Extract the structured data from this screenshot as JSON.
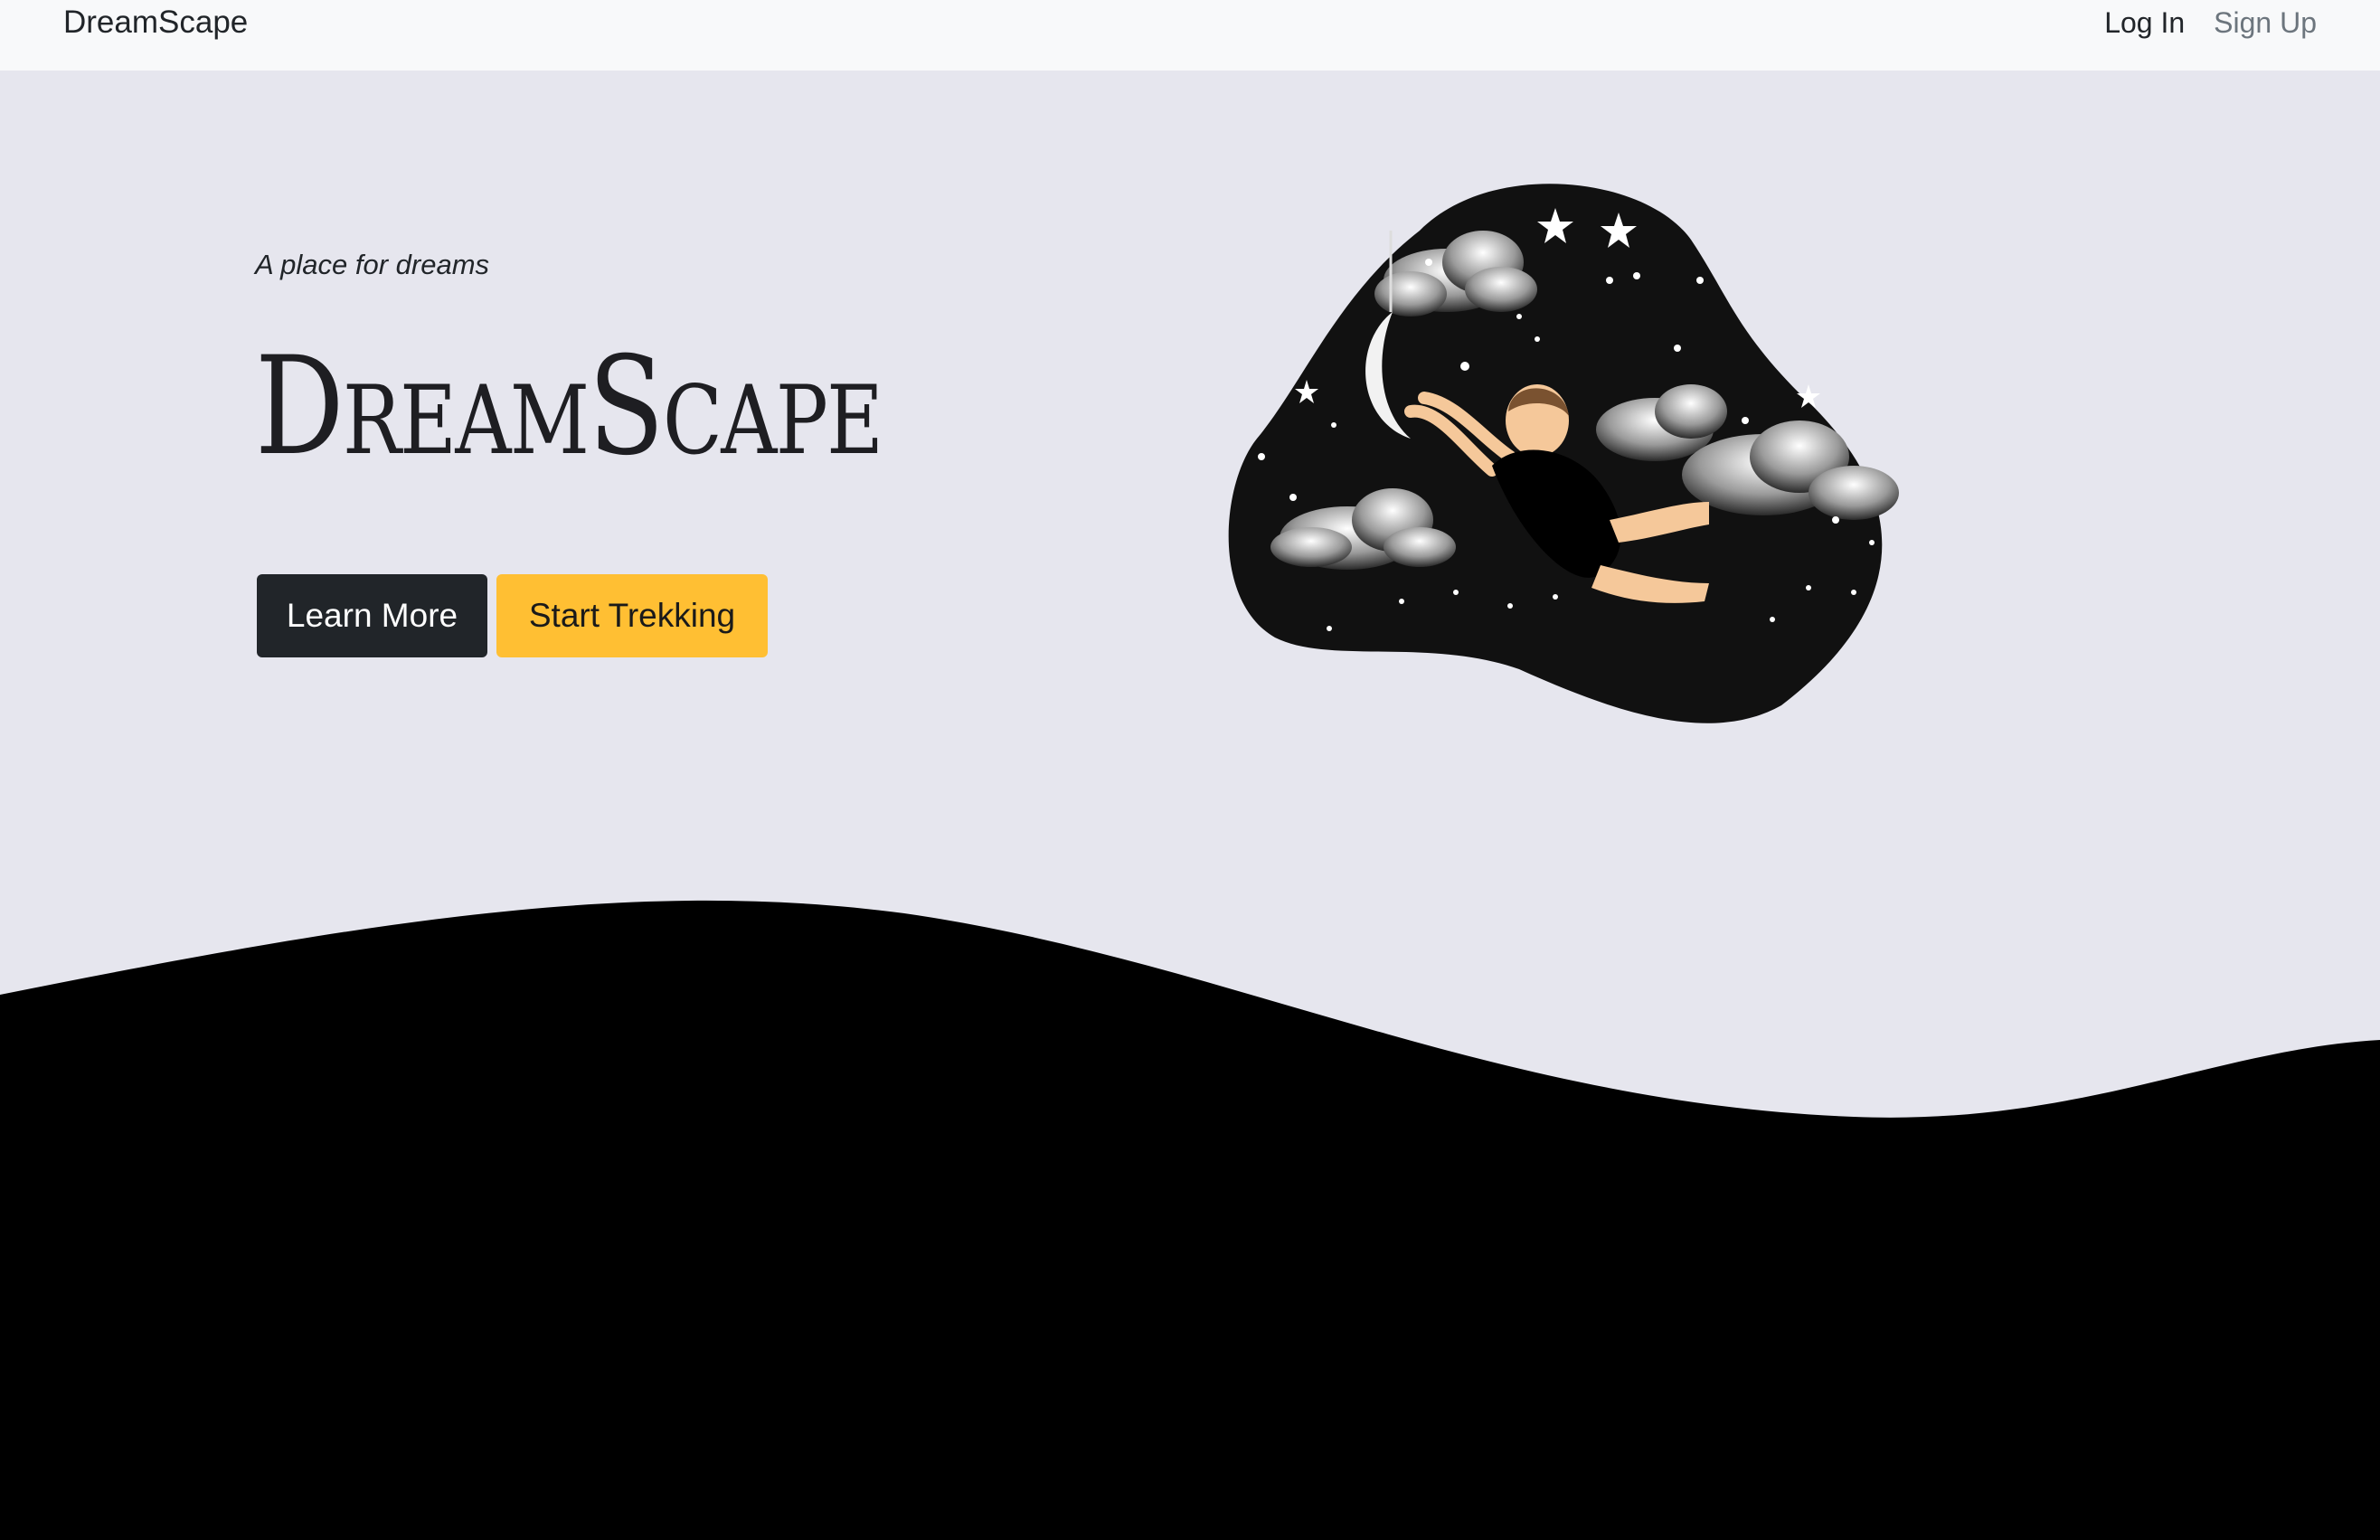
{
  "navbar": {
    "brand": "DreamScape",
    "links": [
      {
        "label": "Log In"
      },
      {
        "label": "Sign Up"
      }
    ]
  },
  "hero": {
    "tagline": "A place for dreams",
    "title": "DreamScape",
    "buttons": {
      "learn_more": "Learn More",
      "start_trekking": "Start Trekking"
    },
    "illustration_icon": "dreamer-reaching-for-moon"
  },
  "colors": {
    "page_bg": "#e6e6ee",
    "navbar_bg": "#f8f9fa",
    "dark_button": "#212529",
    "warning_button": "#ffbf33",
    "wave": "#000000"
  }
}
